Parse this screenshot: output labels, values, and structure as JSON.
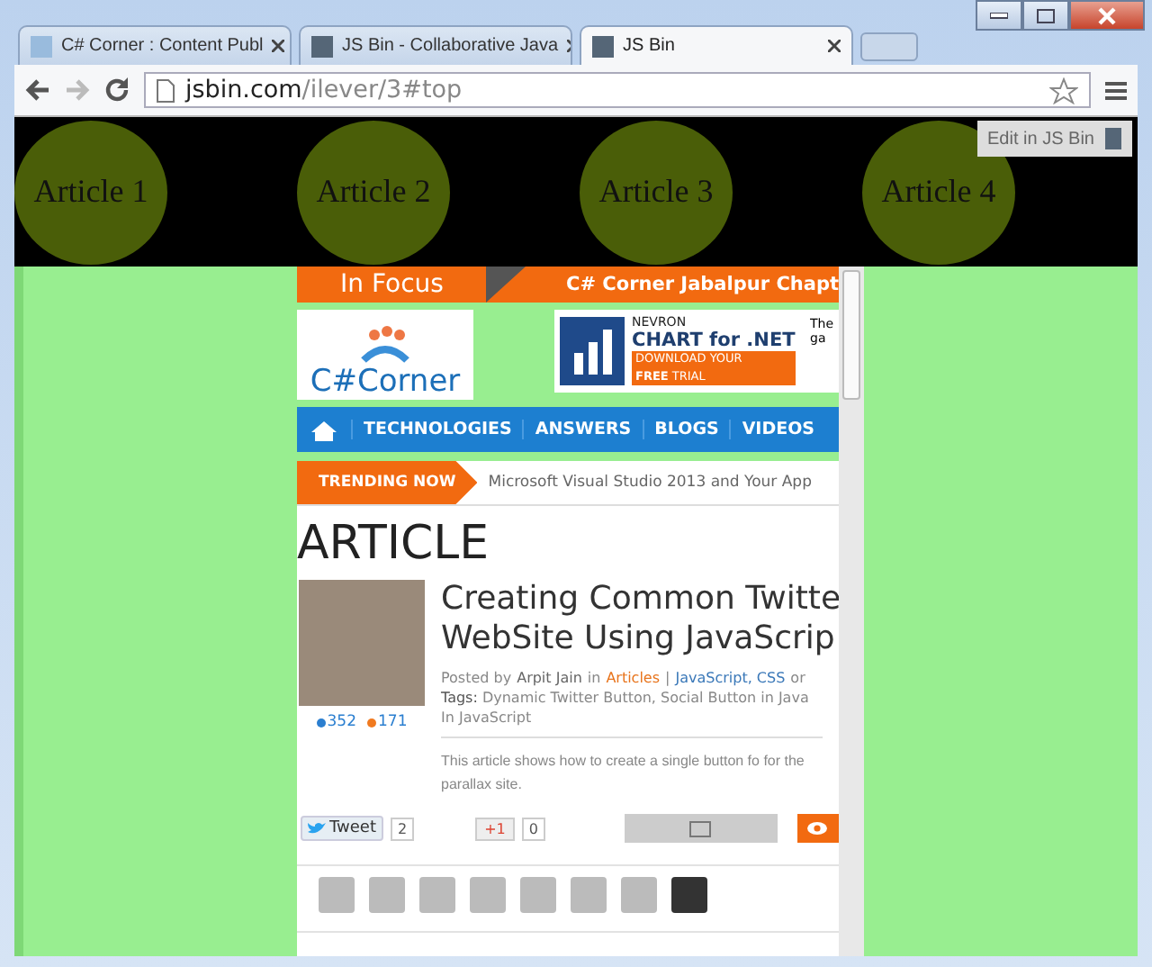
{
  "tabs": [
    {
      "title": "C# Corner : Content Publ",
      "selected": false
    },
    {
      "title": "JS Bin - Collaborative Java",
      "selected": false
    },
    {
      "title": "JS Bin",
      "selected": true
    }
  ],
  "address": {
    "host": "jsbin.com",
    "path": "/ilever/3#top"
  },
  "demo": {
    "articles": [
      "Article 1",
      "Article 2",
      "Article 3",
      "Article 4"
    ],
    "edit_button": "Edit in JS Bin"
  },
  "embedded": {
    "in_focus": "In Focus",
    "focus_news": "C# Corner Jabalpur Chapt",
    "logo": "C#Corner",
    "ad": {
      "brand": "NEVRON",
      "title": "CHART for .NET",
      "cta": "DOWNLOAD YOUR",
      "cta_bold": "FREE",
      "cta_rest": "TRIAL",
      "side": [
        "The",
        "ga"
      ]
    },
    "nav": [
      "TECHNOLOGIES",
      "ANSWERS",
      "BLOGS",
      "VIDEOS"
    ],
    "trending_label": "TRENDING NOW",
    "trending_text": "Microsoft Visual Studio 2013 and Your App",
    "heading": "ARTICLE",
    "article": {
      "title": "Creating Common Twitte WebSite Using JavaScrip",
      "meta": [
        {
          "kind": "text",
          "text": "Posted by"
        },
        {
          "kind": "author",
          "text": "Arpit Jain"
        },
        {
          "kind": "text",
          "text": "in"
        },
        {
          "kind": "category",
          "text": "Articles"
        },
        {
          "kind": "text",
          "text": "|"
        },
        {
          "kind": "link",
          "text": "JavaScript, CSS"
        },
        {
          "kind": "text",
          "text": "or"
        }
      ],
      "tags_label": "Tags:",
      "tags": "Dynamic Twitter Button, Social Button in Java",
      "tags_more": "In JavaScript",
      "counts": [
        {
          "value": "352",
          "color": "#2b7fd0"
        },
        {
          "value": "171",
          "color": "#f07a20"
        }
      ],
      "summary": "This article shows how to create a single button fo for the parallax site."
    },
    "social": {
      "tweet": "Tweet",
      "tweet_count": "2",
      "plus": "+1",
      "plus_count": "0"
    }
  }
}
